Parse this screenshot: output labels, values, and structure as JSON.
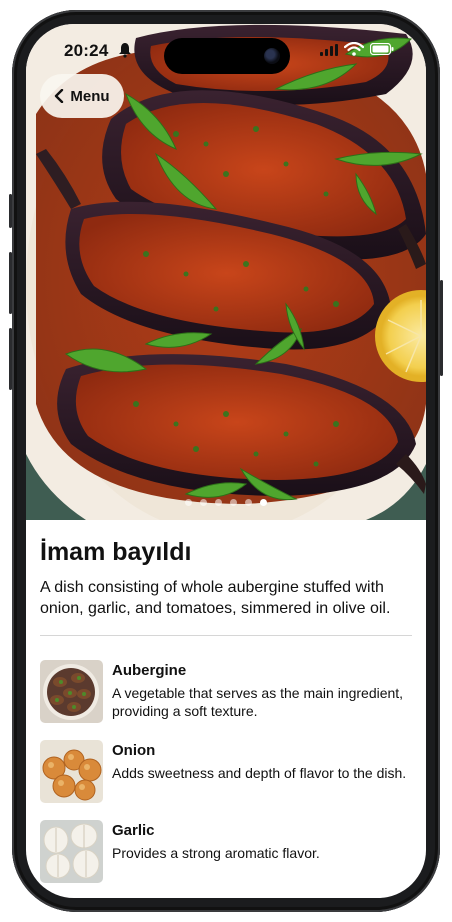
{
  "status_bar": {
    "time": "20:24"
  },
  "nav": {
    "back_label": "Menu"
  },
  "carousel": {
    "page_count": 6,
    "active_index": 5
  },
  "dish": {
    "title": "İmam bayıldı",
    "description": "A dish consisting of whole aubergine stuffed with onion, garlic, and tomatoes, simmered in olive oil."
  },
  "ingredients": [
    {
      "name": "Aubergine",
      "description": "A vegetable that serves as the main ingredient, providing a soft texture."
    },
    {
      "name": "Onion",
      "description": "Adds sweetness and depth of flavor to the dish."
    },
    {
      "name": "Garlic",
      "description": "Provides a strong aromatic flavor."
    }
  ]
}
